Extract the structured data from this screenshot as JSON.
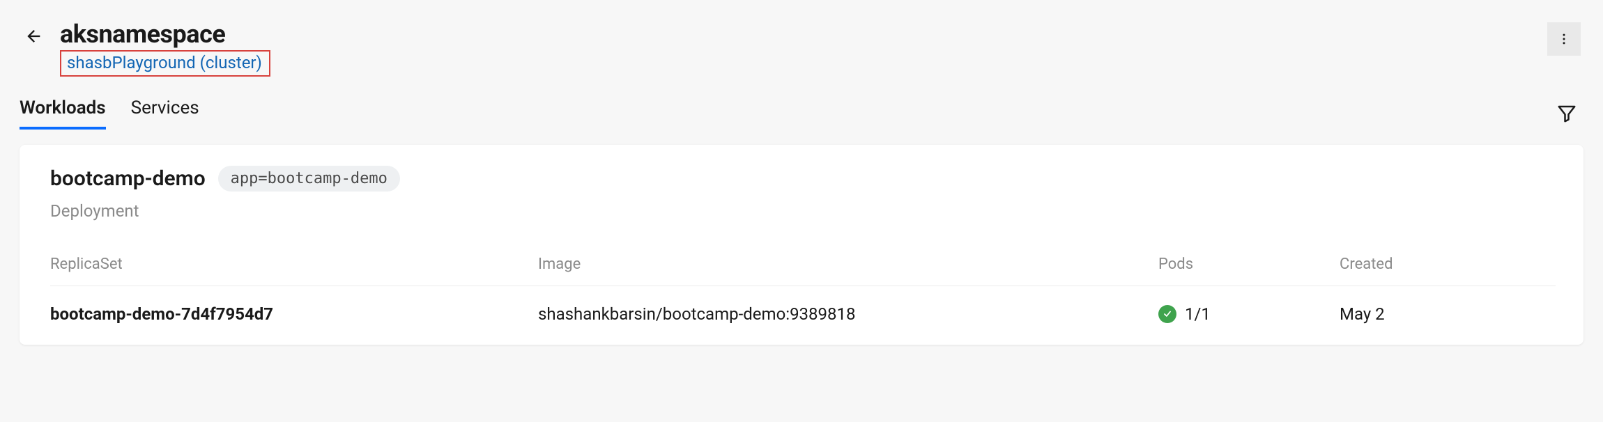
{
  "header": {
    "title": "aksnamespace",
    "breadcrumb": "shasbPlayground (cluster)"
  },
  "tabs": {
    "items": [
      {
        "label": "Workloads",
        "active": true
      },
      {
        "label": "Services",
        "active": false
      }
    ]
  },
  "card": {
    "title": "bootcamp-demo",
    "tag": "app=bootcamp-demo",
    "kind": "Deployment"
  },
  "table": {
    "headers": {
      "replicaset": "ReplicaSet",
      "image": "Image",
      "pods": "Pods",
      "created": "Created"
    },
    "rows": [
      {
        "name": "bootcamp-demo-7d4f7954d7",
        "image": "shashankbarsin/bootcamp-demo:9389818",
        "pods": "1/1",
        "status": "ok",
        "created": "May 2"
      }
    ]
  }
}
